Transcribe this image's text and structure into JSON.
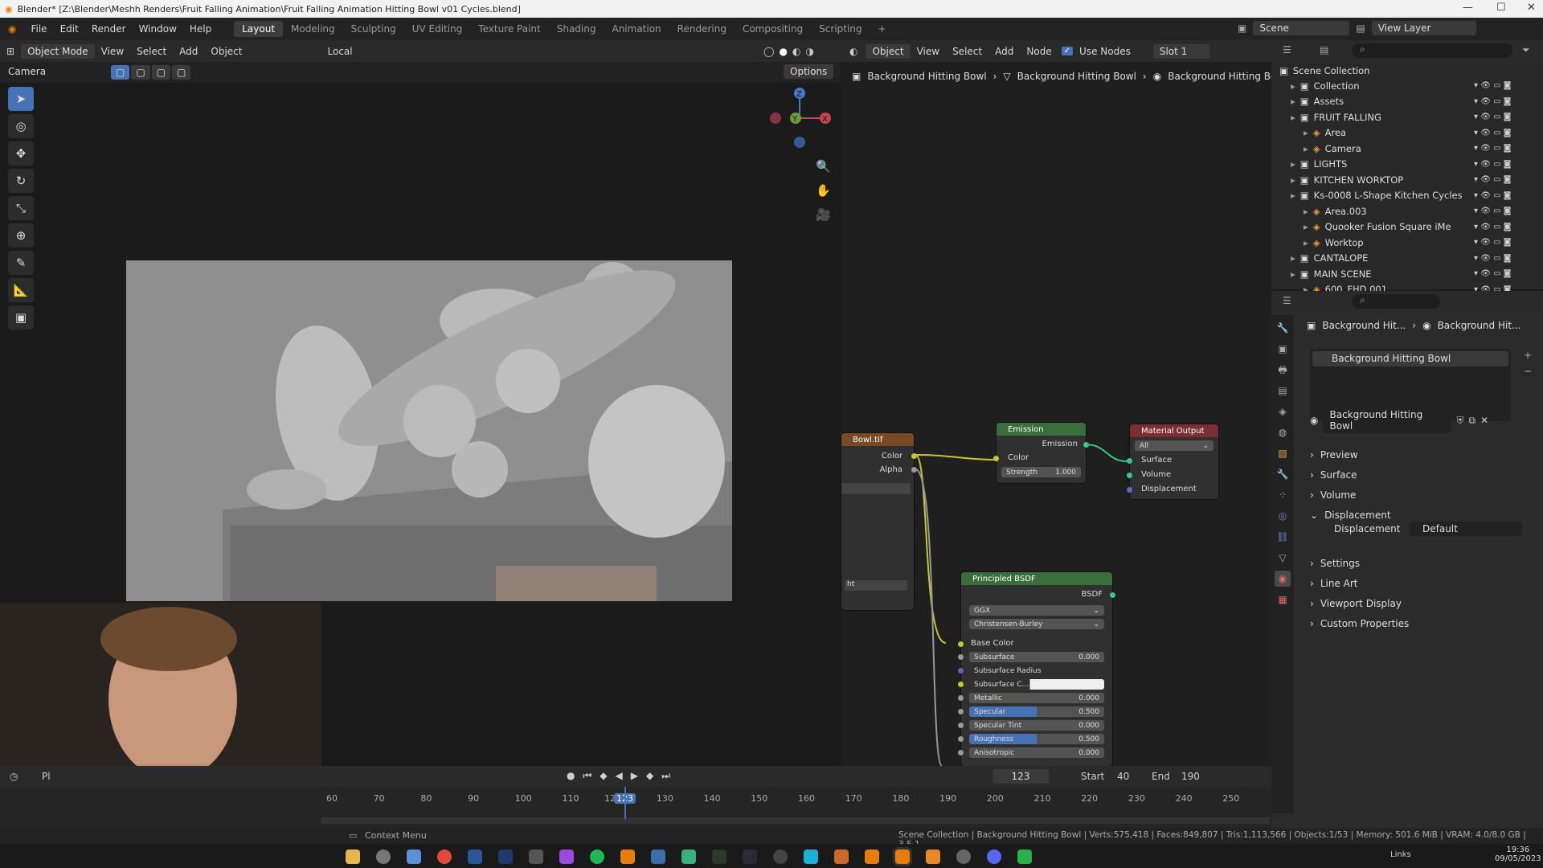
{
  "window": {
    "title": "Blender* [Z:\\Blender\\Meshh Renders\\Fruit Falling Animation\\Fruit Falling Animation Hitting Bowl v01 Cycles.blend]"
  },
  "menu": [
    "File",
    "Edit",
    "Render",
    "Window",
    "Help"
  ],
  "workspaces": [
    "Layout",
    "Modeling",
    "Sculpting",
    "UV Editing",
    "Texture Paint",
    "Shading",
    "Animation",
    "Rendering",
    "Compositing",
    "Scripting"
  ],
  "active_workspace": "Layout",
  "scene": {
    "label": "Scene",
    "view_layer": "View Layer"
  },
  "viewport": {
    "mode": "Object Mode",
    "menus": [
      "View",
      "Select",
      "Add",
      "Object"
    ],
    "transform": "Local",
    "options": "Options",
    "camera": "Camera"
  },
  "node_editor": {
    "type": "Object",
    "menus": [
      "View",
      "Select",
      "Add",
      "Node"
    ],
    "use_nodes": "Use Nodes",
    "slot": "Slot 1",
    "breadcrumb": [
      "Background Hitting Bowl",
      "Background Hitting Bowl",
      "Background Hitting Bowl"
    ],
    "nodes": {
      "image": {
        "title": "Bowl.tif",
        "out_color": "Color",
        "out_alpha": "Alpha",
        "row": "ht"
      },
      "emission": {
        "title": "Emission",
        "out": "Emission",
        "in_color": "Color",
        "strength_label": "Strength",
        "strength": "1.000"
      },
      "material_output": {
        "title": "Material Output",
        "target": "All",
        "surface": "Surface",
        "volume": "Volume",
        "displacement": "Displacement"
      },
      "principled": {
        "title": "Principled BSDF",
        "out": "BSDF",
        "distribution": "GGX",
        "subsurface_method": "Christensen-Burley",
        "base_color": "Base Color",
        "fields": [
          {
            "label": "Subsurface",
            "value": "0.000",
            "fill": 0
          },
          {
            "label": "Subsurface Radius",
            "value": "",
            "fill": 0
          },
          {
            "label": "Subsurface C...",
            "value": "",
            "fill": 0
          },
          {
            "label": "Metallic",
            "value": "0.000",
            "fill": 0
          },
          {
            "label": "Specular",
            "value": "0.500",
            "fill": 0.5
          },
          {
            "label": "Specular Tint",
            "value": "0.000",
            "fill": 0
          },
          {
            "label": "Roughness",
            "value": "0.500",
            "fill": 0.5
          },
          {
            "label": "Anisotropic",
            "value": "0.000",
            "fill": 0
          }
        ]
      }
    }
  },
  "outliner": {
    "root": "Scene Collection",
    "items": [
      {
        "label": "Collection",
        "level": 1
      },
      {
        "label": "Assets",
        "level": 1
      },
      {
        "label": "FRUIT FALLING",
        "level": 1
      },
      {
        "label": "Area",
        "level": 2
      },
      {
        "label": "Camera",
        "level": 2
      },
      {
        "label": "LIGHTS",
        "level": 1
      },
      {
        "label": "KITCHEN WORKTOP",
        "level": 1
      },
      {
        "label": "Ks-0008 L-Shape Kitchen Cycles",
        "level": 1
      },
      {
        "label": "Area.003",
        "level": 2
      },
      {
        "label": "Quooker Fusion Square iMe",
        "level": 2
      },
      {
        "label": "Worktop",
        "level": 2
      },
      {
        "label": "CANTALOPE",
        "level": 1
      },
      {
        "label": "MAIN SCENE",
        "level": 1
      },
      {
        "label": "600_FHD.001",
        "level": 2
      }
    ]
  },
  "properties": {
    "breadcrumb": [
      "Background Hit...",
      "Background Hit..."
    ],
    "slot": "Background Hitting Bowl",
    "material": "Background Hitting Bowl",
    "panels": [
      "Preview",
      "Surface",
      "Volume",
      "Displacement",
      "Settings",
      "Line Art",
      "Viewport Display",
      "Custom Properties"
    ],
    "displacement_label": "Displacement",
    "displacement_value": "Default"
  },
  "timeline": {
    "current_frame": "123",
    "start_label": "Start",
    "start": "40",
    "end_label": "End",
    "end": "190",
    "ticks": [
      "60",
      "70",
      "80",
      "90",
      "100",
      "110",
      "12",
      "123",
      "130",
      "140",
      "150",
      "160",
      "170",
      "180",
      "190",
      "200",
      "210",
      "220",
      "230",
      "240",
      "250"
    ],
    "playback": "Pl"
  },
  "status": {
    "context_menu": "Context Menu",
    "stats": "Scene Collection | Background Hitting Bowl | Verts:575,418 | Faces:849,807 | Tris:1,113,566 | Objects:1/53 | Memory: 501.6 MiB | VRAM: 4.0/8.0 GB | 3.5.1"
  },
  "taskbar": {
    "time": "19:36",
    "date": "09/05/2023",
    "links": "Links"
  }
}
